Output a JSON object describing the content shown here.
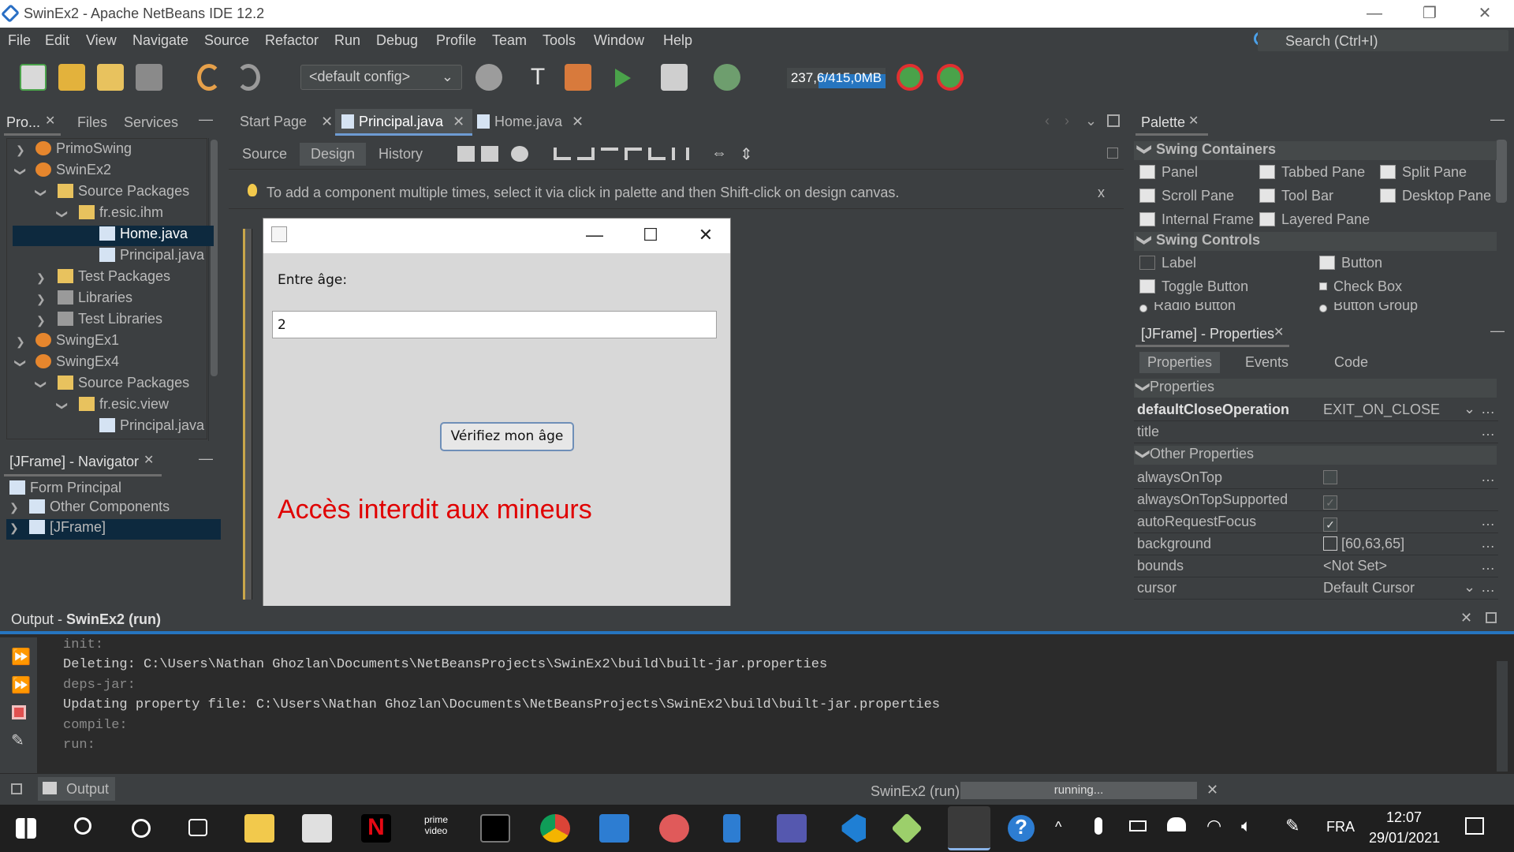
{
  "window": {
    "title": "SwinEx2 - Apache NetBeans IDE 12.2"
  },
  "menu": [
    "File",
    "Edit",
    "View",
    "Navigate",
    "Source",
    "Refactor",
    "Run",
    "Debug",
    "Profile",
    "Team",
    "Tools",
    "Window",
    "Help"
  ],
  "search": {
    "placeholder": "Search (Ctrl+I)"
  },
  "toolbar": {
    "config": "<default config>",
    "memory": "237,6/415,0MB"
  },
  "project_tabs": {
    "projects": "Pro...",
    "files": "Files",
    "services": "Services"
  },
  "project_tree": [
    "PrimoSwing",
    "SwinEx2",
    "Source Packages",
    "fr.esic.ihm",
    "Home.java",
    "Principal.java",
    "Test Packages",
    "Libraries",
    "Test Libraries",
    "SwingEx1",
    "SwingEx4",
    "Source Packages",
    "fr.esic.view",
    "Principal.java"
  ],
  "navigator": {
    "title": "[JFrame] - Navigator",
    "items": [
      "Form Principal",
      "Other Components",
      "[JFrame]"
    ]
  },
  "editor_tabs": [
    "Start Page",
    "Principal.java",
    "Home.java"
  ],
  "editor_subtabs": [
    "Source",
    "Design",
    "History"
  ],
  "hint": "To add a component multiple times, select it via click in palette and then Shift-click on design canvas.",
  "hint_close": "x",
  "java_window": {
    "label": "Entre âge:",
    "input_value": "2",
    "button": "Vérifiez mon âge",
    "message": "Accès interdit aux mineurs"
  },
  "palette": {
    "title": "Palette",
    "containers_title": "Swing Containers",
    "containers": [
      "Panel",
      "Tabbed Pane",
      "Split Pane",
      "Scroll Pane",
      "Tool Bar",
      "Desktop Pane",
      "Internal Frame",
      "Layered Pane"
    ],
    "controls_title": "Swing Controls",
    "controls": [
      "Label",
      "Button",
      "Toggle Button",
      "Check Box",
      "Radio Button",
      "Button Group"
    ]
  },
  "properties": {
    "title": "[JFrame] - Properties",
    "tabs": [
      "Properties",
      "Events",
      "Code"
    ],
    "section1": "Properties",
    "section2": "Other Properties",
    "rows": [
      {
        "k": "defaultCloseOperation",
        "v": "EXIT_ON_CLOSE"
      },
      {
        "k": "title",
        "v": ""
      },
      {
        "k": "alwaysOnTop",
        "v": ""
      },
      {
        "k": "alwaysOnTopSupported",
        "v": ""
      },
      {
        "k": "autoRequestFocus",
        "v": ""
      },
      {
        "k": "background",
        "v": "[60,63,65]"
      },
      {
        "k": "bounds",
        "v": "<Not Set>"
      },
      {
        "k": "cursor",
        "v": "Default Cursor"
      }
    ]
  },
  "output": {
    "title": "Output - ",
    "title_bold": "SwinEx2 (run)",
    "lines": [
      "init:",
      "Deleting: C:\\Users\\Nathan Ghozlan\\Documents\\NetBeansProjects\\SwinEx2\\build\\built-jar.properties",
      "deps-jar:",
      "Updating property file: C:\\Users\\Nathan Ghozlan\\Documents\\NetBeansProjects\\SwinEx2\\build\\built-jar.properties",
      "compile:",
      "run:"
    ]
  },
  "status": {
    "output_tab": "Output",
    "task": "SwinEx2 (run)",
    "progress": "running..."
  },
  "taskbar": {
    "lang": "FRA",
    "time": "12:07",
    "date": "29/01/2021"
  }
}
